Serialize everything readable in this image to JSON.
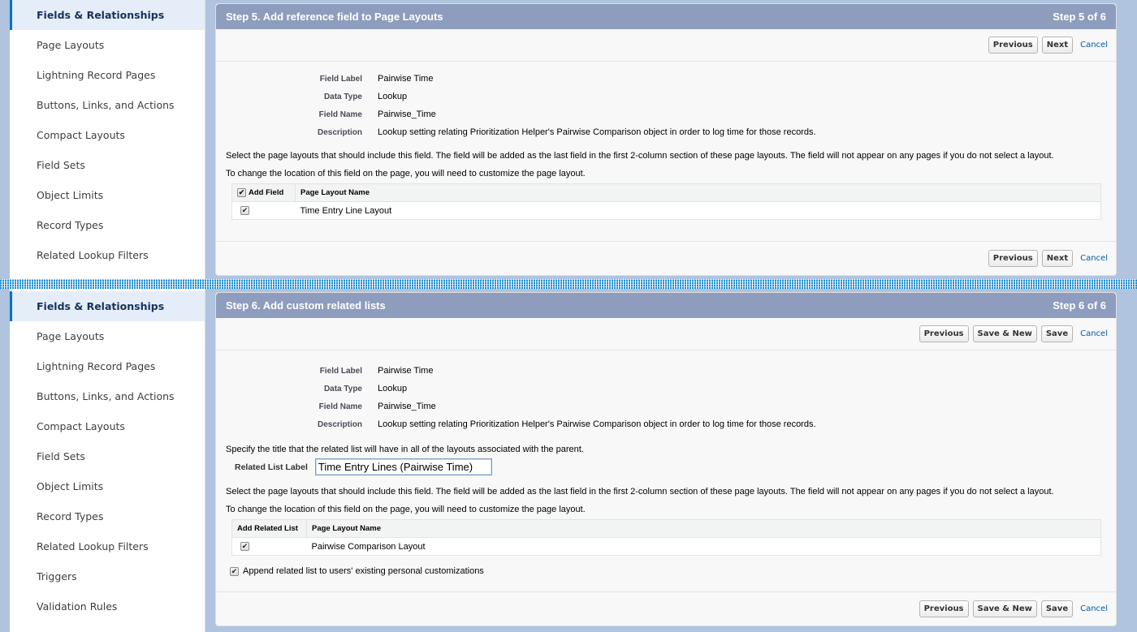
{
  "sidebar_top": {
    "items": [
      {
        "label": "Fields & Relationships",
        "active": true
      },
      {
        "label": "Page Layouts"
      },
      {
        "label": "Lightning Record Pages"
      },
      {
        "label": "Buttons, Links, and Actions"
      },
      {
        "label": "Compact Layouts"
      },
      {
        "label": "Field Sets"
      },
      {
        "label": "Object Limits"
      },
      {
        "label": "Record Types"
      },
      {
        "label": "Related Lookup Filters"
      }
    ]
  },
  "sidebar_bottom": {
    "items": [
      {
        "label": "Fields & Relationships",
        "active": true
      },
      {
        "label": "Page Layouts"
      },
      {
        "label": "Lightning Record Pages"
      },
      {
        "label": "Buttons, Links, and Actions"
      },
      {
        "label": "Compact Layouts"
      },
      {
        "label": "Field Sets"
      },
      {
        "label": "Object Limits"
      },
      {
        "label": "Record Types"
      },
      {
        "label": "Related Lookup Filters"
      },
      {
        "label": "Triggers"
      },
      {
        "label": "Validation Rules"
      }
    ]
  },
  "step5": {
    "title": "Step 5. Add reference field to Page Layouts",
    "step_indicator": "Step 5 of 6",
    "buttons": {
      "previous": "Previous",
      "next": "Next",
      "cancel": "Cancel"
    },
    "details": [
      {
        "label": "Field Label",
        "value": "Pairwise Time"
      },
      {
        "label": "Data Type",
        "value": "Lookup"
      },
      {
        "label": "Field Name",
        "value": "Pairwise_Time"
      },
      {
        "label": "Description",
        "value": "Lookup setting relating Prioritization Helper's Pairwise Comparison object in order to log time for those records."
      }
    ],
    "instruction_1": "Select the page layouts that should include this field. The field will be added as the last field in the first 2-column section of these page layouts. The field will not appear on any pages if you do not select a layout.",
    "instruction_2": "To change the location of this field on the page, you will need to customize the page layout.",
    "table": {
      "headers": [
        "Add Field",
        "Page Layout Name"
      ],
      "header_checked": true,
      "rows": [
        {
          "checked": true,
          "name": "Time Entry Line Layout"
        }
      ]
    }
  },
  "step6": {
    "title": "Step 6. Add custom related lists",
    "step_indicator": "Step 6 of 6",
    "buttons": {
      "previous": "Previous",
      "save_new": "Save & New",
      "save": "Save",
      "cancel": "Cancel"
    },
    "details": [
      {
        "label": "Field Label",
        "value": "Pairwise Time"
      },
      {
        "label": "Data Type",
        "value": "Lookup"
      },
      {
        "label": "Field Name",
        "value": "Pairwise_Time"
      },
      {
        "label": "Description",
        "value": "Lookup setting relating Prioritization Helper's Pairwise Comparison object in order to log time for those records."
      }
    ],
    "title_instruction": "Specify the title that the related list will have in all of the layouts associated with the parent.",
    "related_list_label": "Related List Label",
    "related_list_value": "Time Entry Lines (Pairwise Time)",
    "instruction_1": "Select the page layouts that should include this field. The field will be added as the last field in the first 2-column section of these page layouts. The field will not appear on any pages if you do not select a layout.",
    "instruction_2": "To change the location of this field on the page, you will need to customize the page layout.",
    "table": {
      "headers": [
        "Add Related List",
        "Page Layout Name"
      ],
      "rows": [
        {
          "checked": true,
          "name": "Pairwise Comparison Layout"
        }
      ]
    },
    "append_label": "Append related list to users' existing personal customizations",
    "append_checked": true
  },
  "colors": {
    "header_bg": "#8e9dbd",
    "active_accent": "#0070d2",
    "link": "#015ba7",
    "background": "#b0c4df"
  }
}
